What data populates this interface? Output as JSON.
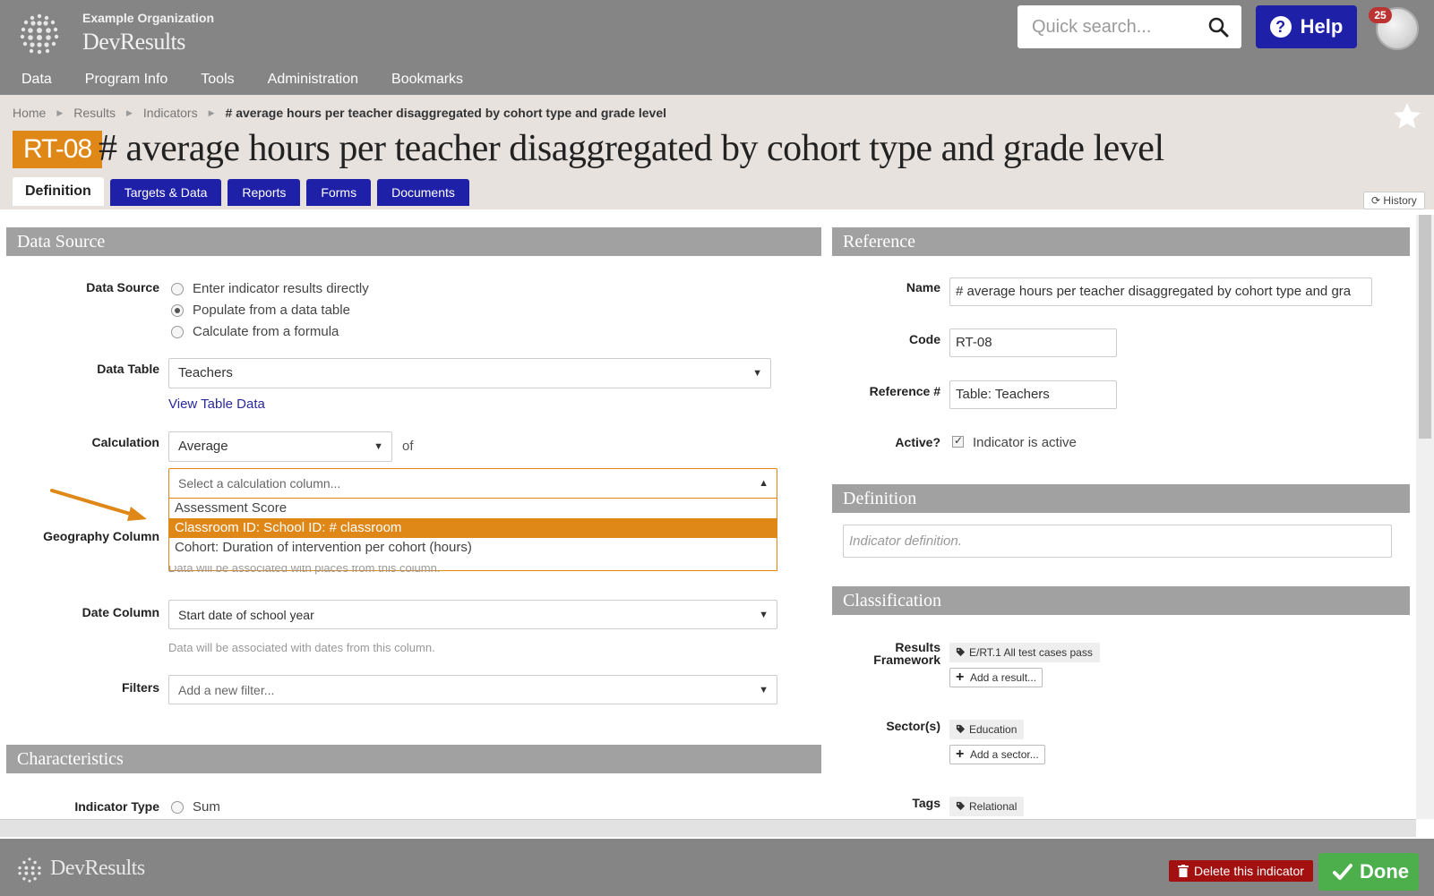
{
  "header": {
    "org_name": "Example Organization",
    "app_name": "DevResults",
    "search_placeholder": "Quick search...",
    "help_label": "Help",
    "notification_count": "25",
    "nav": [
      "Data",
      "Program Info",
      "Tools",
      "Administration",
      "Bookmarks"
    ]
  },
  "breadcrumb": [
    "Home",
    "Results",
    "Indicators",
    "# average hours per teacher disaggregated by cohort type and grade level"
  ],
  "indicator": {
    "code": "RT-08",
    "title": "# average hours per teacher disaggregated by cohort type and grade level"
  },
  "tabs": [
    "Definition",
    "Targets & Data",
    "Reports",
    "Forms",
    "Documents"
  ],
  "history_label": "History",
  "data_source": {
    "heading": "Data Source",
    "label": "Data Source",
    "options": [
      "Enter indicator results directly",
      "Populate from a data table",
      "Calculate from a formula"
    ],
    "selected": "Populate from a data table",
    "data_table_label": "Data Table",
    "data_table_value": "Teachers",
    "view_table_link": "View Table Data",
    "calculation_label": "Calculation",
    "calculation_value": "Average",
    "of_text": "of",
    "column_placeholder": "Select a calculation column...",
    "column_options": [
      "Assessment Score",
      "Classroom ID: School ID: # classroom",
      "Cohort: Duration of intervention per cohort (hours)"
    ],
    "highlighted_option": "Classroom ID: School ID: # classroom",
    "geography_label": "Geography Column",
    "geography_hint": "Data will be associated with places from this column.",
    "date_label": "Date Column",
    "date_value": "Start date of school year",
    "date_hint": "Data will be associated with dates from this column.",
    "filters_label": "Filters",
    "filters_placeholder": "Add a new filter..."
  },
  "characteristics": {
    "heading": "Characteristics",
    "indicator_type_label": "Indicator Type",
    "indicator_type_option": "Sum"
  },
  "reference": {
    "heading": "Reference",
    "name_label": "Name",
    "name_value": "# average hours per teacher disaggregated by cohort type and gra",
    "code_label": "Code",
    "code_value": "RT-08",
    "refnum_label": "Reference #",
    "refnum_value": "Table: Teachers",
    "active_label": "Active?",
    "active_text": "Indicator is active"
  },
  "definition": {
    "heading": "Definition",
    "placeholder": "Indicator definition."
  },
  "classification": {
    "heading": "Classification",
    "results_label_1": "Results",
    "results_label_2": "Framework",
    "results_tag": "E/RT.1 All test cases pass",
    "add_result": "Add a result...",
    "sectors_label": "Sector(s)",
    "sector_tag": "Education",
    "add_sector": "Add a sector...",
    "tags_label": "Tags",
    "tag_value": "Relational"
  },
  "footer": {
    "app_name": "DevResults",
    "delete_label": "Delete this indicator",
    "done_label": "Done"
  },
  "colors": {
    "header_bg": "#858585",
    "accent_orange": "#df8717",
    "tab_blue": "#1f20a8",
    "done_green": "#4caf4c",
    "delete_red": "#a31010"
  }
}
